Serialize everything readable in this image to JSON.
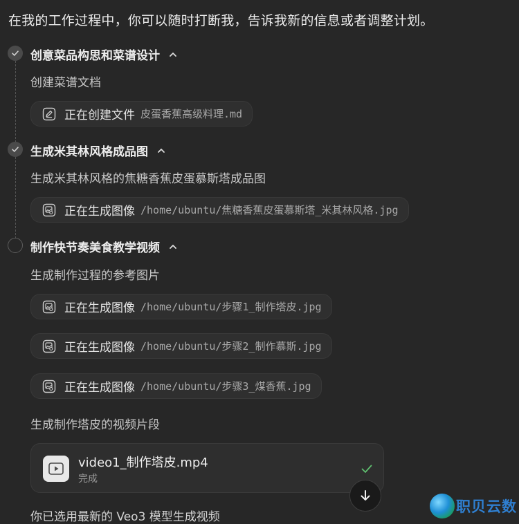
{
  "intro": "在我的工作过程中，你可以随时打断我，告诉我新的信息或者调整计划。",
  "steps": [
    {
      "title": "创意菜品构思和菜谱设计",
      "status": "done",
      "subtitle": "创建菜谱文档",
      "actions": [
        {
          "icon": "edit-icon",
          "label": "正在创建文件",
          "file": "皮蛋香蕉高级料理.md"
        }
      ]
    },
    {
      "title": "生成米其林风格成品图",
      "status": "done",
      "subtitle": "生成米其林风格的焦糖香蕉皮蛋慕斯塔成品图",
      "actions": [
        {
          "icon": "image-icon",
          "label": "正在生成图像",
          "file": "/home/ubuntu/焦糖香蕉皮蛋慕斯塔_米其林风格.jpg"
        }
      ]
    },
    {
      "title": "制作快节奏美食教学视频",
      "status": "pending",
      "subtitle": "生成制作过程的参考图片",
      "actions": [
        {
          "icon": "image-icon",
          "label": "正在生成图像",
          "file": "/home/ubuntu/步骤1_制作塔皮.jpg"
        },
        {
          "icon": "image-icon",
          "label": "正在生成图像",
          "file": "/home/ubuntu/步骤2_制作慕斯.jpg"
        },
        {
          "icon": "image-icon",
          "label": "正在生成图像",
          "file": "/home/ubuntu/步骤3_煤香蕉.jpg"
        }
      ],
      "subtitle2": "生成制作塔皮的视频片段",
      "video": {
        "name": "video1_制作塔皮.mp4",
        "status": "完成",
        "icon": "play-icon"
      }
    }
  ],
  "last_message": "你已选用最新的 Veo3 模型生成视频",
  "scroll_button_icon": "arrow-down-icon",
  "watermark": {
    "text": "职贝云数",
    "icon": "globe-logo"
  },
  "colors": {
    "background": "#272727",
    "chip": "#2f2f2f",
    "check_green": "#5fbf6f",
    "watermark_blue": "#2f7fd0"
  }
}
